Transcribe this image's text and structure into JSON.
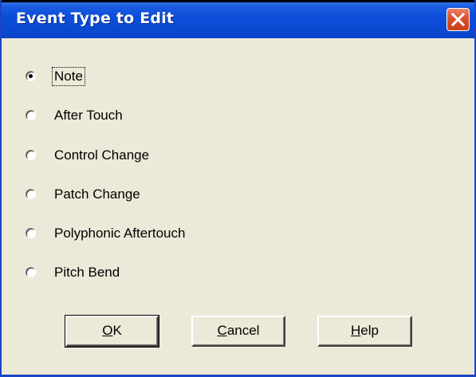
{
  "window": {
    "title": "Event Type to Edit",
    "close_icon": "close-icon"
  },
  "event_types": {
    "selected": "Note",
    "options": [
      {
        "label": "Note",
        "checked": true
      },
      {
        "label": "After Touch",
        "checked": false
      },
      {
        "label": "Control Change",
        "checked": false
      },
      {
        "label": "Patch Change",
        "checked": false
      },
      {
        "label": "Polyphonic Aftertouch",
        "checked": false
      },
      {
        "label": "Pitch Bend",
        "checked": false
      }
    ]
  },
  "buttons": {
    "ok": {
      "mnemonic": "O",
      "rest": "K"
    },
    "cancel": {
      "mnemonic": "C",
      "rest": "ancel"
    },
    "help": {
      "mnemonic": "H",
      "rest": "elp"
    }
  },
  "colors": {
    "title_bar": "#0b4bd6",
    "close_button": "#d9512c",
    "dialog_face": "#ece9d8"
  }
}
